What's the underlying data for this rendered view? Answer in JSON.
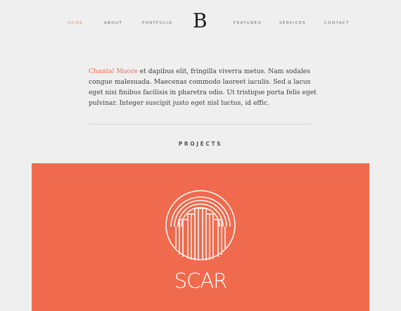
{
  "nav": {
    "items": [
      {
        "label": "HOME",
        "active": true
      },
      {
        "label": "ABOUT",
        "active": false
      },
      {
        "label": "PORTFOLIO",
        "active": false
      },
      {
        "label": "FEATURED",
        "active": false
      },
      {
        "label": "SERVICES",
        "active": false
      },
      {
        "label": "CONTACT",
        "active": false
      }
    ],
    "brand": "B"
  },
  "intro": {
    "author": "Chantal Moore",
    "text": " et dapibus elit, fringilla viverra metus. Nam sodales congue malesuada. Maecenas commodo laoreet iaculis. Sed a lacus eget nisi finibus facilisis in pharetra odio. Ut tristique porta felis eget pulvinar. Integer suscipit justo eget nisl luctus, id effic."
  },
  "projects": {
    "title": "PROJECTS",
    "items": [
      {
        "name": "SCAR",
        "logo": "arched-building-circle-icon",
        "color": "#f06b4d"
      }
    ]
  },
  "colors": {
    "accent": "#ef6e4e",
    "background": "#efefef",
    "card": "#f06b4d"
  }
}
